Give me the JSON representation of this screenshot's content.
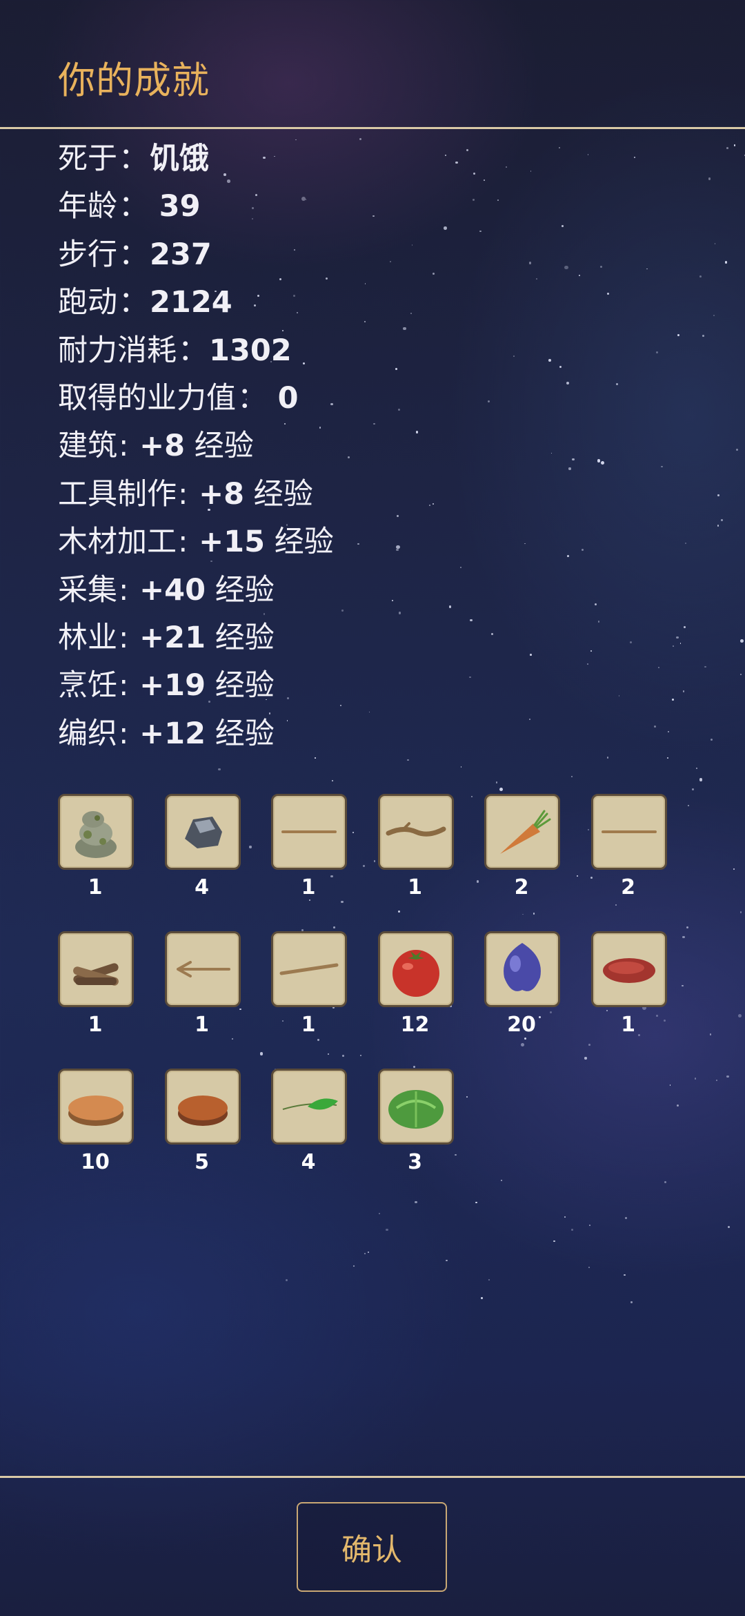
{
  "header": {
    "title": "你的成就"
  },
  "stats": [
    {
      "label": "死于",
      "sep": "：",
      "value": "饥饿",
      "suffix": ""
    },
    {
      "label": "年龄",
      "sep": "： ",
      "value": "39",
      "suffix": ""
    },
    {
      "label": "步行",
      "sep": "：",
      "value": "237",
      "suffix": ""
    },
    {
      "label": "跑动",
      "sep": "：",
      "value": "2124",
      "suffix": ""
    },
    {
      "label": "耐力消耗",
      "sep": "：",
      "value": "1302",
      "suffix": ""
    },
    {
      "label": "取得的业力值",
      "sep": "： ",
      "value": "0",
      "suffix": ""
    },
    {
      "label": "建筑",
      "sep": ": ",
      "value": "+8",
      "suffix": " 经验"
    },
    {
      "label": "工具制作",
      "sep": ": ",
      "value": "+8",
      "suffix": " 经验"
    },
    {
      "label": "木材加工",
      "sep": ": ",
      "value": "+15",
      "suffix": " 经验"
    },
    {
      "label": "采集",
      "sep": ": ",
      "value": "+40",
      "suffix": " 经验"
    },
    {
      "label": "林业",
      "sep": ": ",
      "value": "+21",
      "suffix": " 经验"
    },
    {
      "label": "烹饪",
      "sep": ": ",
      "value": "+19",
      "suffix": " 经验"
    },
    {
      "label": "编织",
      "sep": ": ",
      "value": "+12",
      "suffix": " 经验"
    }
  ],
  "items": [
    {
      "icon": "mossy-rock-icon",
      "count": "1"
    },
    {
      "icon": "flint-stone-icon",
      "count": "4"
    },
    {
      "icon": "thin-stick-icon",
      "count": "1"
    },
    {
      "icon": "branch-icon",
      "count": "1"
    },
    {
      "icon": "carrot-icon",
      "count": "2"
    },
    {
      "icon": "thin-stick-icon",
      "count": "2"
    },
    {
      "icon": "firewood-icon",
      "count": "1"
    },
    {
      "icon": "forked-stick-icon",
      "count": "1"
    },
    {
      "icon": "long-stick-icon",
      "count": "1"
    },
    {
      "icon": "tomato-icon",
      "count": "12"
    },
    {
      "icon": "blue-fruit-icon",
      "count": "20"
    },
    {
      "icon": "raw-meat-icon",
      "count": "1"
    },
    {
      "icon": "flatbread-icon",
      "count": "10"
    },
    {
      "icon": "baked-bread-icon",
      "count": "5"
    },
    {
      "icon": "leaf-icon",
      "count": "4"
    },
    {
      "icon": "cabbage-icon",
      "count": "3"
    }
  ],
  "footer": {
    "confirm_label": "确认"
  },
  "colors": {
    "title": "#e8b25c",
    "divider": "#d9c9a6",
    "tile": "#d6c9a6",
    "button_text": "#e3b86c"
  }
}
